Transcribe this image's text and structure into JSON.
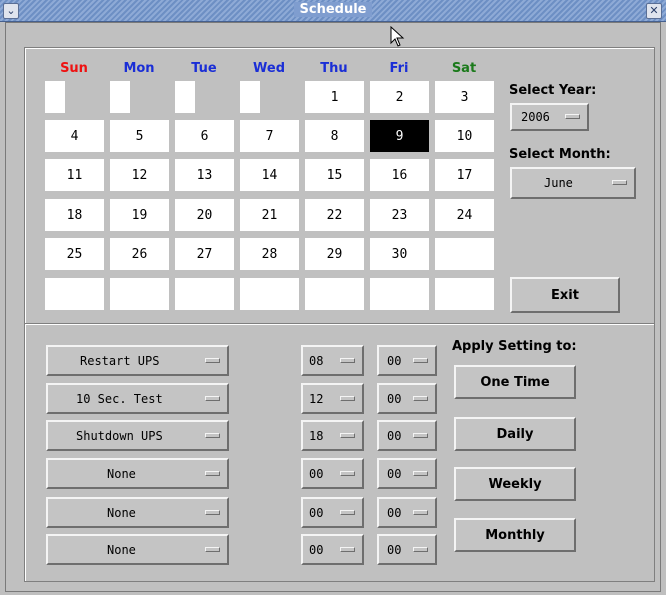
{
  "window": {
    "title": "Schedule",
    "menu_glyph": "⌄",
    "close_glyph": "✕"
  },
  "calendar": {
    "weekdays": [
      {
        "label": "Sun",
        "color": "#ee1111"
      },
      {
        "label": "Mon",
        "color": "#1a2ed6"
      },
      {
        "label": "Tue",
        "color": "#1a2ed6"
      },
      {
        "label": "Wed",
        "color": "#1a2ed6"
      },
      {
        "label": "Thu",
        "color": "#1a2ed6"
      },
      {
        "label": "Fri",
        "color": "#1a2ed6"
      },
      {
        "label": "Sat",
        "color": "#1b7a1b"
      }
    ],
    "weeks": [
      [
        "",
        "",
        "",
        "",
        "1",
        "2",
        "3"
      ],
      [
        "4",
        "5",
        "6",
        "7",
        "8",
        "9",
        "10"
      ],
      [
        "11",
        "12",
        "13",
        "14",
        "15",
        "16",
        "17"
      ],
      [
        "18",
        "19",
        "20",
        "21",
        "22",
        "23",
        "24"
      ],
      [
        "25",
        "26",
        "27",
        "28",
        "29",
        "30",
        ""
      ],
      [
        "",
        "",
        "",
        "",
        "",
        "",
        ""
      ]
    ],
    "selected_day": "9"
  },
  "side": {
    "year_label": "Select Year:",
    "year_value": "2006",
    "month_label": "Select Month:",
    "month_value": "June",
    "exit_label": "Exit"
  },
  "schedule": {
    "rows": [
      {
        "action": "Restart UPS",
        "hour": "08",
        "minute": "00"
      },
      {
        "action": "10 Sec. Test",
        "hour": "12",
        "minute": "00"
      },
      {
        "action": "Shutdown UPS",
        "hour": "18",
        "minute": "00"
      },
      {
        "action": "None",
        "hour": "00",
        "minute": "00"
      },
      {
        "action": "None",
        "hour": "00",
        "minute": "00"
      },
      {
        "action": "None",
        "hour": "00",
        "minute": "00"
      }
    ],
    "apply_label": "Apply Setting to:",
    "one_time_label": "One Time",
    "daily_label": "Daily",
    "weekly_label": "Weekly",
    "monthly_label": "Monthly"
  }
}
